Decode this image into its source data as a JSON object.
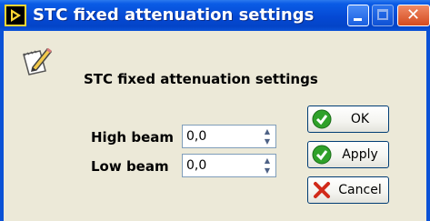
{
  "window": {
    "title": "STC fixed attenuation settings",
    "close_glyph": "✕",
    "app_icon": "labview-run-icon"
  },
  "dialog": {
    "heading": "STC fixed attenuation settings",
    "heading_icon": "edit-pencil-icon"
  },
  "fields": {
    "high_beam": {
      "label": "High beam",
      "value": "0,0"
    },
    "low_beam": {
      "label": "Low beam",
      "value": "0,0"
    }
  },
  "buttons": {
    "ok": {
      "label": "OK",
      "icon": "checkmark-icon"
    },
    "apply": {
      "label": "Apply",
      "icon": "checkmark-icon"
    },
    "cancel": {
      "label": "Cancel",
      "icon": "red-x-icon"
    }
  },
  "colors": {
    "titlebar": "#0549d4",
    "client_background": "#ece9d8",
    "check_green": "#2fa12a",
    "cancel_red": "#d12a1a"
  }
}
